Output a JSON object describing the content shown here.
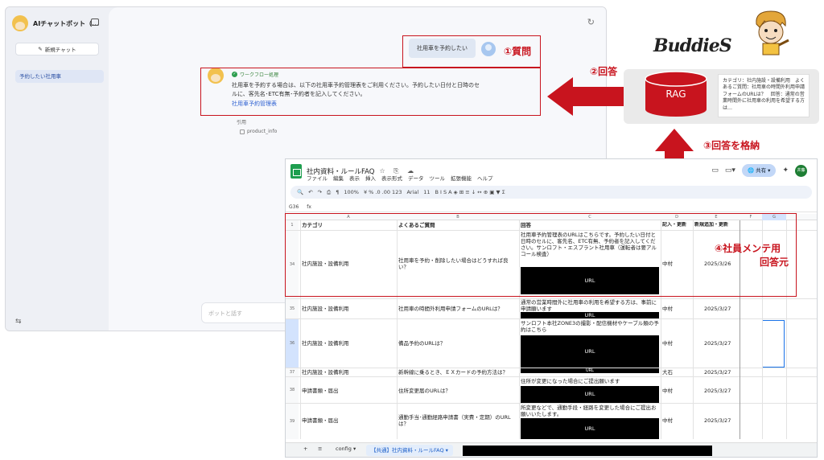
{
  "chat": {
    "app_title": "AIチャットボット（...",
    "new_chat": "新規チャット",
    "history_item": "予約したい社用車",
    "user_message": "社用車を予約したい",
    "workflow_badge": "ワークフロー処理",
    "bot_message": "社用車を予約する場合は、以下の社用車予約管理表をご利用ください。予約したい日付と日時のセルに、客先名･ETC有無･予約者を記入してください。",
    "bot_link": "社用車予約管理表",
    "citation_label": "引用",
    "citation_item": "product_info",
    "input_placeholder": "ボットと話す"
  },
  "annotations": {
    "question": "①質問",
    "answer": "②回答",
    "store": "③回答を格納",
    "maintain_line1": "④社員メンテ用",
    "maintain_line2": "回答元"
  },
  "diagram": {
    "logo": "BuddieS",
    "rag_label": "RAG",
    "note_text": "カテゴリ：社内施設・設備利用　よくあるご質問：社用車の時間外利用申請フォームのURLは？　回答：通常の営業時間外に社用車の利用を希望する方は…",
    "colors": {
      "accent_red": "#c8141e",
      "rag_fill": "#c8141e"
    }
  },
  "sheet": {
    "doc_title": "社内資料・ルールFAQ",
    "title_icons": "☆ ⎘ ☁",
    "menus": [
      "ファイル",
      "編集",
      "表示",
      "挿入",
      "表示形式",
      "データ",
      "ツール",
      "拡張機能",
      "ヘルプ"
    ],
    "share_label": "共有",
    "user_badge": "井藤",
    "zoom": "100%",
    "font": "Arial",
    "font_size": "11",
    "cell_ref": "G36",
    "fx": "fx",
    "col_letters": [
      "A",
      "B",
      "C",
      "D",
      "E",
      "F",
      "G"
    ],
    "headers": [
      "カテゴリ",
      "よくあるご質問",
      "回答",
      "記入・更新",
      "新規追加・更新"
    ],
    "url_label": "URL",
    "rows": [
      {
        "num": "34",
        "category": "社内施設・設備利用",
        "question": "社用車を予約・削除したい場合はどうすれば良い？",
        "answer": "社用車予約管理表のURLはこちらです。予約したい日付と日時のセルに、客先名、ETC有無、予約者を記入してください。サンロフト・エスプラント社用車（運転者は要アルコール検査）",
        "person": "中村",
        "date": "2025/3/26"
      },
      {
        "num": "35",
        "category": "社内施設・設備利用",
        "question": "社用車の時間外利用申請フォームのURLは？",
        "answer": "通常の営業時間外に社用車の利用を希望する方は、事前に申請願います",
        "person": "中村",
        "date": "2025/3/27"
      },
      {
        "num": "36",
        "category": "社内施設・設備利用",
        "question": "備品予約のURLは？",
        "answer": "サンロフト本社ZONE3の撮影・配信機材やケーブル類の予約はこちら",
        "person": "中村",
        "date": "2025/3/27"
      },
      {
        "num": "37",
        "category": "社内施設・設備利用",
        "question": "新幹線に乗るとき、ＥＸカードの予約方法は？",
        "answer": "",
        "person": "大石",
        "date": "2025/3/27"
      },
      {
        "num": "38",
        "category": "申請書類・届出",
        "question": "住所変更届のURLは？",
        "answer": "住所が変更になった場合にご提出願います",
        "person": "中村",
        "date": "2025/3/27"
      },
      {
        "num": "39",
        "category": "申請書類・届出",
        "question": "通勤手当･通勤経路申請書（実費・定期）のURLは？",
        "answer": "所変更などで、通勤手段・経路を変更した場合にご提出お願いいたします。",
        "person": "中村",
        "date": "2025/3/27"
      }
    ],
    "tabs": [
      "config",
      "【共通】社内資料・ルールFAQ"
    ]
  }
}
